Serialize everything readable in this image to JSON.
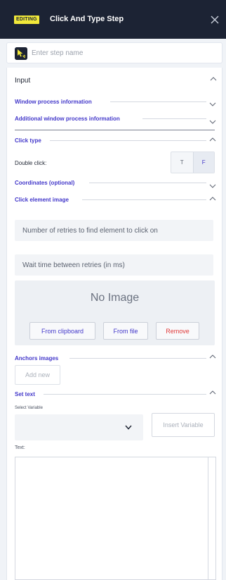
{
  "header": {
    "badge": "EDITING",
    "title": "Click And Type Step"
  },
  "step_name": {
    "placeholder": "Enter step name",
    "value": ""
  },
  "panel": {
    "title": "Input",
    "sections": {
      "window_process": "Window process information",
      "additional_window": "Additional window process information",
      "click_type": "Click type",
      "coordinates": "Coordinates (optional)",
      "click_element_image": "Click element image",
      "anchors_images": "Anchors images",
      "set_text": "Set text"
    },
    "double_click": {
      "label": "Double click:",
      "options": [
        "T",
        "F"
      ],
      "selected": "F"
    },
    "retries_placeholder": "Number of retries to find element to click on",
    "wait_placeholder": "Wait time between retries (in ms)",
    "image_box": {
      "empty_text": "No Image",
      "from_clipboard": "From clipboard",
      "from_file": "From file",
      "remove": "Remove"
    },
    "add_new": "Add new",
    "select_variable_label": "Select Variable",
    "insert_variable": "Insert Variable",
    "text_label": "Text:"
  },
  "colors": {
    "header_bg": "#1c2334",
    "accent": "#4338ca",
    "badge": "#f2e93a",
    "danger": "#e03a3a"
  },
  "icons": [
    "close-icon",
    "step-type-icon",
    "chevron-up-icon",
    "chevron-down-icon"
  ]
}
